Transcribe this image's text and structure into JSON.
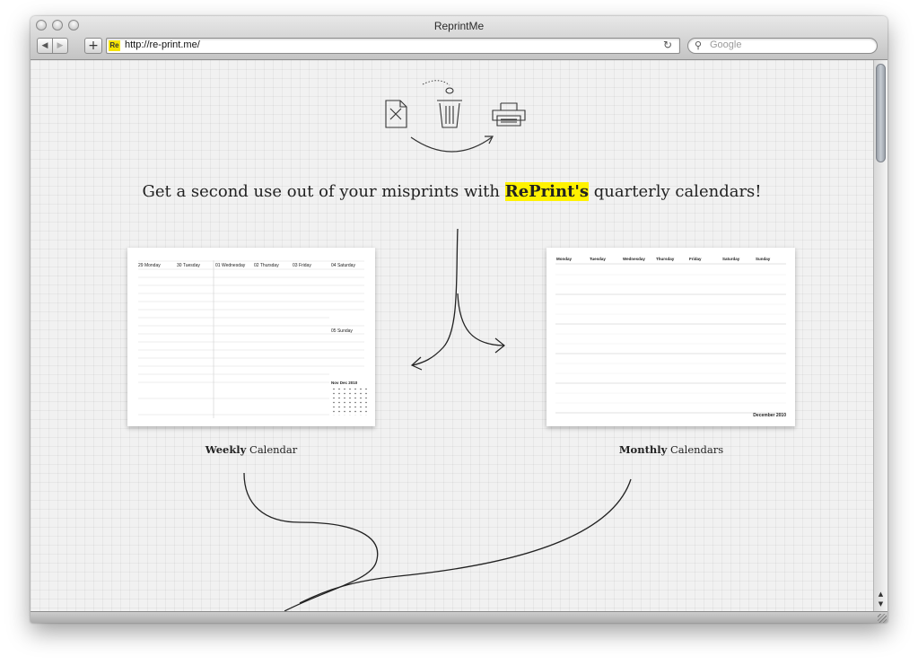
{
  "window": {
    "title": "ReprintMe"
  },
  "toolbar": {
    "favicon": "Re",
    "url": "http://re-print.me/",
    "search_placeholder": "Google",
    "back_icon": "◀",
    "forward_icon": "▶",
    "add_icon": "+",
    "reload_icon": "↻"
  },
  "page": {
    "headline_pre": "Get a second use out of your misprints with ",
    "headline_brand": "RePrint's",
    "headline_post": " quarterly calendars!",
    "weekly": {
      "bold": "Weekly",
      "rest": " Calendar"
    },
    "monthly": {
      "bold": "Monthly",
      "rest": " Calendars"
    }
  },
  "weekly_preview": {
    "days": [
      "29 Monday",
      "30 Tuesday",
      "01 Wednesday",
      "02 Thursday",
      "03 Friday",
      "04 Saturday"
    ],
    "sunday": "05 Sunday",
    "mini_title": "Nov Dec 2010"
  },
  "monthly_preview": {
    "days": [
      "Monday",
      "Tuesday",
      "Wednesday",
      "Thursday",
      "Friday",
      "Saturday",
      "Sunday"
    ],
    "month_label": "December 2010"
  },
  "colors": {
    "highlight": "#fff200",
    "grid_bg": "#f1f1f1"
  }
}
